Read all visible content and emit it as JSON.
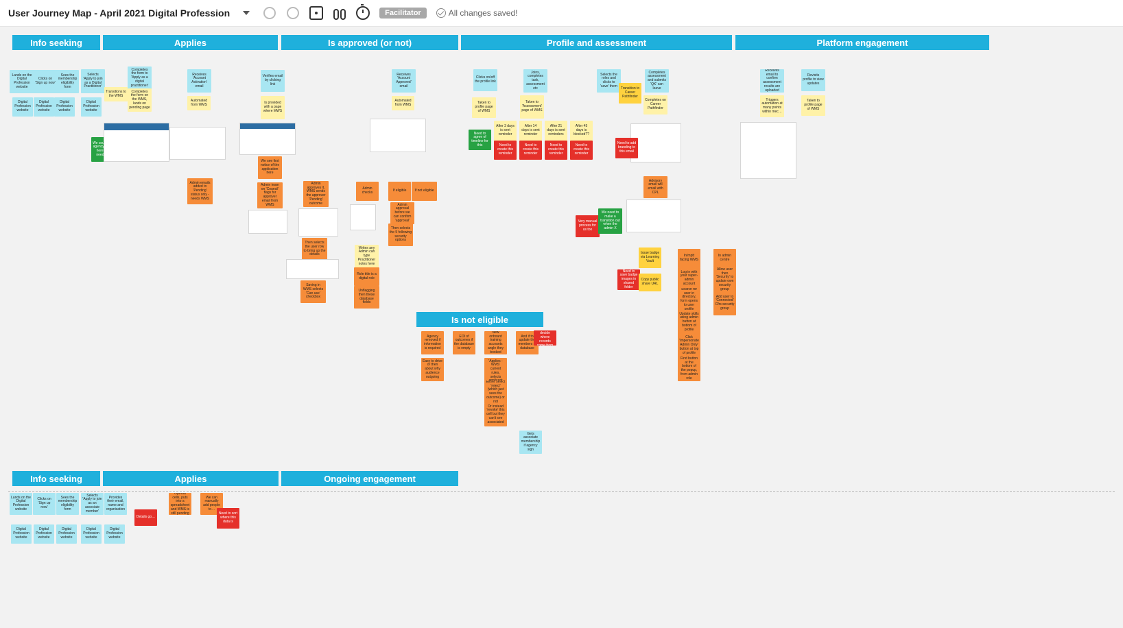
{
  "toolbar": {
    "title": "User Journey Map - April 2021 Digital Profession",
    "facilitator": "Facilitator",
    "saved": "All changes saved!"
  },
  "sections": {
    "s1": "Info seeking",
    "s2": "Applies",
    "s3": "Is approved (or not)",
    "s4": "Profile and assessment",
    "s5": "Platform engagement",
    "s6": "Is not eligible",
    "s7": "Info seeking",
    "s8": "Applies",
    "s9": "Ongoing engagement"
  },
  "notes": {
    "info1": "Lands on the Digital Profession website",
    "info2": "Clicks on 'Sign up now'",
    "info3": "Sees the membership eligibility form",
    "info1b": "Digital Profession website",
    "info2b": "Digital Profession website",
    "info3b": "Digital Profession website",
    "apply1": "Selects 'Apply to join as a Digital Practitioner'",
    "apply2": "Completes the form to 'Apply as a digital practitioner'",
    "apply3": "Receives 'Account Activation' email",
    "apply3b": "Automated from WMS",
    "applyTrans": "Transitions to the WMS",
    "apply4": "Completes the form on the WMS, lands on pending page",
    "apply5": "We could raise agency issues here if we needed to",
    "apply1b": "Digital Profession website",
    "applyA1": "Admin emails added to 'Pending' status only - needs WMS",
    "appr1": "Verifies email by clicking link",
    "appr2": "Is provided with a page where MWS",
    "apprFirst": "We see first notice of the application here",
    "apprA1": "Admin team on 'Council' flags for approver email from WMS",
    "apprA2": "Admin approves it, WMS sends the approver 'Pending' outcome",
    "apprA3": "Then selects the user row to bring up the details",
    "apprA4": "Saving in WMS selects 'Can use' checkbox",
    "apprA5": "Role title is a digital role",
    "apprA6": "Unflagging then these database fields",
    "apprR1": "Admin checks",
    "apprR2": "If eligible",
    "apprR3": "If not eligible",
    "apprR4": "Then selects the 5 following security options",
    "apprQ1": "Admin approval before we can confirm 'approval'",
    "apprC1": "Writes any Admin can type Practitioner notes here",
    "appR": "Receives 'Account Approved' email",
    "appRAut": "Automated from WMS",
    "prof1": "Clicks on/off the profile link",
    "prof2": "Joins, completes task, assessment etc",
    "prof2b": "Taken to 'Assessment' page of WMS",
    "prof3": "Taken to profile page of WMS",
    "prof4": "After 3 days is sent reminder",
    "prof5": "After 14 days is sent reminder",
    "prof6": "After 21 days is sent reminders",
    "prof7": "After 45 days is blocked??",
    "profNA": "Need to agree of timeline for this",
    "profN1": "Need to create this reminder",
    "profN2": "Need to create this reminder",
    "profN3": "Need to create this reminder",
    "profN4": "Need to create this reminder",
    "profManual": "Very manual process for us too",
    "profSel": "Selects the roles and clicks to 'save' them",
    "profTrans": "Transition to Career Pathfinder",
    "profComp": "Completes assessment and submits 'QK' can leave",
    "profCompCP": "Completes on Career Pathfinder",
    "profBranding": "Need to add branding to this email",
    "profAdvisory": "Advisory email will email with CPL",
    "profGn": "We need to make a transition out when the admin X",
    "profBadge": "Issue badge via Learning Vault",
    "profBadgeR": "Need to save badge images in shared folder",
    "profCopy": "Copy public share URL",
    "profInH": "In/mptt facing WMS",
    "profLog": "Log in with your super-admin account",
    "profSearch": "Search for user in directory, form opens to user profile",
    "profUpdate": "Update skills using admin button at bottom of profile",
    "profClick": "Click 'Impersonate Admin Only' button at top of profile",
    "profFind": "Find button at the bottom of the popup, from admin role",
    "profAdmin": "In admin centre",
    "profSecU": "Allow user then 'Security' to update own security group",
    "profAdd": "Add user to 'Connected' Cfrs security group",
    "plat1": "Receives email to confirm assessment results are uploaded",
    "plat2": "Revisits profile to view updates",
    "plat3": "Triggers automation at many points within mec…",
    "plat4": "Taken to profile page of WMS",
    "ne1": "Agency removed if information is required",
    "ne2": "EOI of outcomes if the database is empty",
    "ne3": "New onboard training accounts angle they booked",
    "ne4": "And if to update the members in database",
    "ne5": "Need to decide where records come from",
    "ne6": "Easy to drive or then about why audience outgoing",
    "ne7": "Admin sees 'Applies - WMS' current rules, selects applicant",
    "ne8": "Either select 'reject' (which just sees the outcome) or not",
    "ne9": "Or instead 'revoke' this cell but they can't see associated",
    "neEnd": "Gets associate membership if agency sign",
    "l2a": "Lands on the Digital Profession website",
    "l2b": "Clicks on 'Sign up now'",
    "l2c": "Sees the membership eligibility form",
    "l2d": "Selects 'Apply to join as an associate member'",
    "l2e": "Provides their email, name and organisation",
    "l2f": "Details go…",
    "l2g": "Opt-out cells, puts into a spreadsheet and WMS is still pending",
    "l2h": "We can manually add people to…",
    "l2i": "Need to sort where this data is",
    "l2j": "Digital Profession website",
    "l2k": "Digital Profession website",
    "l2l": "Digital Profession website",
    "l2m": "Digital Profession website",
    "l2n": "Digital Profession website"
  }
}
